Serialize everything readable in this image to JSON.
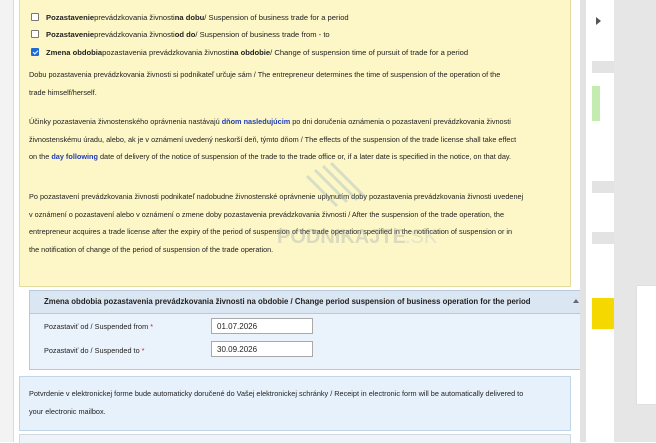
{
  "options": [
    {
      "checked": false,
      "before": "Pozastavenie",
      "mid": " prevádzkovania živnosti ",
      "bold": "na dobu",
      "after": " / Suspension of business trade for a period"
    },
    {
      "checked": false,
      "before": "Pozastavenie",
      "mid": " prevádzkovania živnosti ",
      "bold": "od do",
      "after": " / Suspension of business trade from - to"
    },
    {
      "checked": true,
      "before": "Zmena obdobia",
      "mid": " pozastavenia prevádzkovania živnosti ",
      "bold": "na obdobie",
      "after": " / Change of suspension time of pursuit of trade for a period"
    }
  ],
  "para1": {
    "l1": "Dobu pozastavenia prevádzkovania živnosti si podnikateľ určuje sám / The entrepreneur determines the time of suspension of the operation of the",
    "l2": "trade himself/herself."
  },
  "para2": {
    "l1a": "Účinky pozastavenia živnostenského oprávnenia nastávajú ",
    "l1b": "dňom nasledujúcim",
    "l1c": " po dni doručenia oznámenia o pozastavení prevádzkovania živnosti",
    "l2": "živnostenskému úradu, alebo, ak je v oznámení uvedený neskorší deň, týmto dňom / The effects of the suspension of the trade license shall take effect",
    "l3a": "on the ",
    "l3b": "day following",
    "l3c": " date of delivery of the notice of suspension of the trade to the trade office or, if a later date is specified in the notice, on that day."
  },
  "para3": {
    "l1": "Po pozastavení prevádzkovania živnosti podnikateľ nadobudne živnostenské oprávnenie uplynutím doby pozastavenia prevádzkovania živnosti uvedenej",
    "l2": "v oznámení o pozastavení alebo v oznámení o zmene doby pozastavenia prevádzkovania živnosti / After the suspension of the trade operation, the",
    "l3": "entrepreneur acquires a trade license after the expiry of the period of suspension of the trade operation specified in the notification of suspension or in",
    "l4": "the notification of change of the period of suspension of the trade operation."
  },
  "watermark": {
    "text_a": "PODNIKAJTE",
    "text_b": ".SK"
  },
  "period_section": {
    "title": "Zmena obdobia pozastavenia prevádzkovania živnosti na obdobie / Change period suspension of business operation for the period",
    "from_label": "Pozastaviť od / Suspended from",
    "from_value": "01.07.2026",
    "to_label": "Pozastaviť do / Suspended to",
    "to_value": "30.09.2026",
    "required_mark": "*"
  },
  "info": {
    "l1": "Potvrdenie v elektronickej forme bude automaticky doručené do Vašej elektronickej schránky / Receipt in electronic form will be automatically delivered to",
    "l2": "your electronic mailbox."
  },
  "colors": {
    "accent": "#1c6bd6",
    "panel": "#fdf6c6",
    "highlight": "#1f3fb8",
    "required": "#d21c1c"
  }
}
